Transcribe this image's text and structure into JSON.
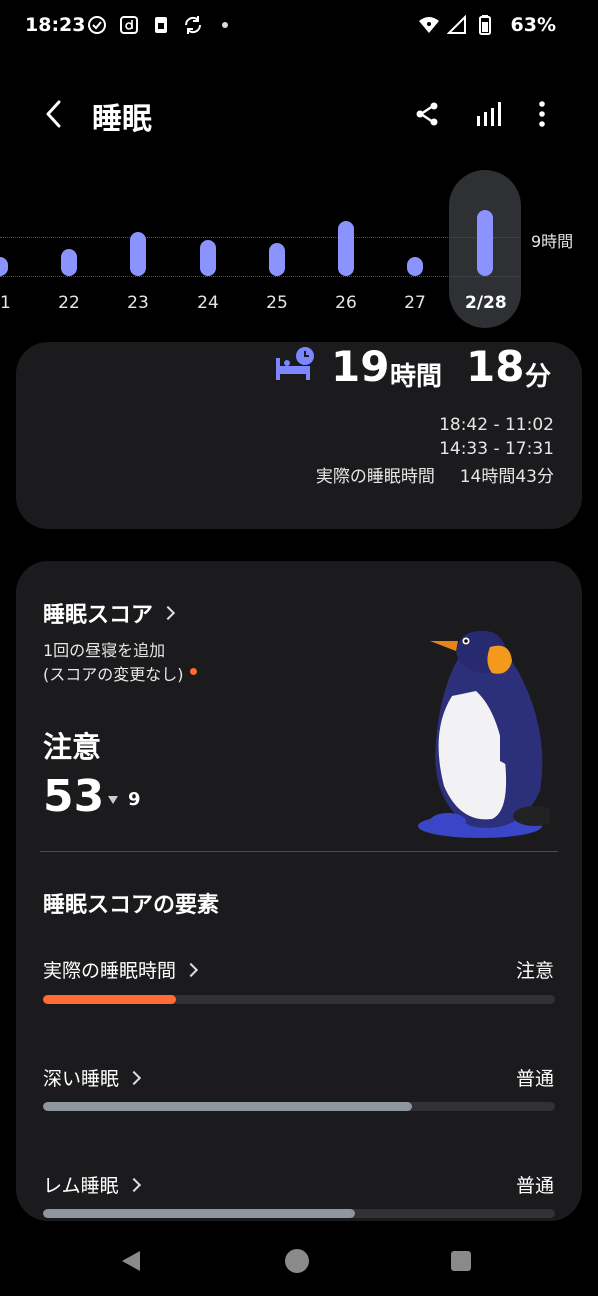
{
  "status_bar": {
    "time": "18:23",
    "battery": "63%",
    "left_icons": [
      "check-circle-icon",
      "d-app-icon",
      "sim-icon",
      "sync-icon",
      "dot-icon"
    ],
    "right_icons": [
      "wifi-icon",
      "signal-icon",
      "battery-icon"
    ]
  },
  "app_bar": {
    "title": "睡眠",
    "actions": [
      "share-icon",
      "chart-icon",
      "more-icon"
    ]
  },
  "timeline": {
    "reference_label": "9時間",
    "days": [
      {
        "label": "21",
        "hours": 3.5
      },
      {
        "label": "22",
        "hours": 5.0
      },
      {
        "label": "23",
        "hours": 8.0
      },
      {
        "label": "24",
        "hours": 6.5
      },
      {
        "label": "25",
        "hours": 6.0
      },
      {
        "label": "26",
        "hours": 10.0
      },
      {
        "label": "27",
        "hours": 3.5
      },
      {
        "label": "2/28",
        "hours": 12.0,
        "selected": true
      }
    ]
  },
  "summary": {
    "hours_value": "19",
    "hours_unit": "時間",
    "minutes_value": "18",
    "minutes_unit": "分",
    "range_1": "18:42 - 11:02",
    "range_2": "14:33 - 17:31",
    "actual_label": "実際の睡眠時間",
    "actual_value": "14時間43分"
  },
  "score": {
    "title": "睡眠スコア",
    "nap_line1": "1回の昼寝を追加",
    "nap_line2": "(スコアの変更なし)",
    "status": "注意",
    "value": "53",
    "delta": "9",
    "elements_title": "睡眠スコアの要素",
    "factors": [
      {
        "label": "実際の睡眠時間",
        "status": "注意",
        "level": 0.26,
        "color": "#ff6a35"
      },
      {
        "label": "深い睡眠",
        "status": "普通",
        "level": 0.72,
        "color": "#8e969e"
      },
      {
        "label": "レム睡眠",
        "status": "普通",
        "level": 0.61,
        "color": "#8e969e"
      }
    ]
  },
  "colors": {
    "accent": "#8b93ff",
    "warning": "#ff6a35",
    "card": "#1b1b1d"
  }
}
